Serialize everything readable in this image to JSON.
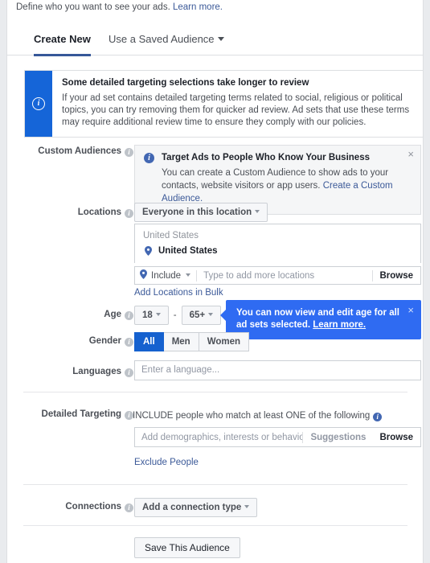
{
  "intro": {
    "text": "Define who you want to see your ads.",
    "link": "Learn more."
  },
  "tabs": [
    {
      "label": "Create New",
      "active": true
    },
    {
      "label": "Use a Saved Audience",
      "active": false
    }
  ],
  "banner": {
    "icon": "info-icon",
    "title": "Some detailed targeting selections take longer to review",
    "body": "If your ad set contains detailed targeting terms related to social, religious or political topics, you can try removing them for quicker ad review. Ad sets that use these terms may require additional review time to ensure they comply with our policies.",
    "stripe_color": "#1565d8"
  },
  "custom_audiences": {
    "label": "Custom Audiences",
    "callout_title": "Target Ads to People Who Know Your Business",
    "callout_text": "You can create a Custom Audience to show ads to your contacts, website visitors or app users.",
    "callout_link": "Create a Custom Audience.",
    "close": "×"
  },
  "locations": {
    "label": "Locations",
    "scope_button": "Everyone in this location",
    "group_header": "United States",
    "selected_item": "United States",
    "include_label": "Include",
    "placeholder": "Type to add more locations",
    "browse_label": "Browse",
    "bulk_link": "Add Locations in Bulk"
  },
  "age": {
    "label": "Age",
    "min": "18",
    "max": "65+",
    "separator": "-"
  },
  "tooltip": {
    "text": "You can now view and edit age for all ad sets selected.",
    "link": "Learn more.",
    "close": "×",
    "color": "#2f6bf2"
  },
  "gender": {
    "label": "Gender",
    "options": [
      {
        "label": "All",
        "selected": true
      },
      {
        "label": "Men",
        "selected": false
      },
      {
        "label": "Women",
        "selected": false
      }
    ],
    "selected_color": "#1561cf"
  },
  "languages": {
    "label": "Languages",
    "placeholder": "Enter a language...",
    "value": ""
  },
  "detailed_targeting": {
    "label": "Detailed Targeting",
    "include_header": "INCLUDE people who match at least ONE of the following",
    "placeholder": "Add demographics, interests or behaviors",
    "suggestions_label": "Suggestions",
    "browse_label": "Browse",
    "exclude_link": "Exclude People"
  },
  "connections": {
    "label": "Connections",
    "button": "Add a connection type"
  },
  "footer": {
    "save_button": "Save This Audience"
  }
}
